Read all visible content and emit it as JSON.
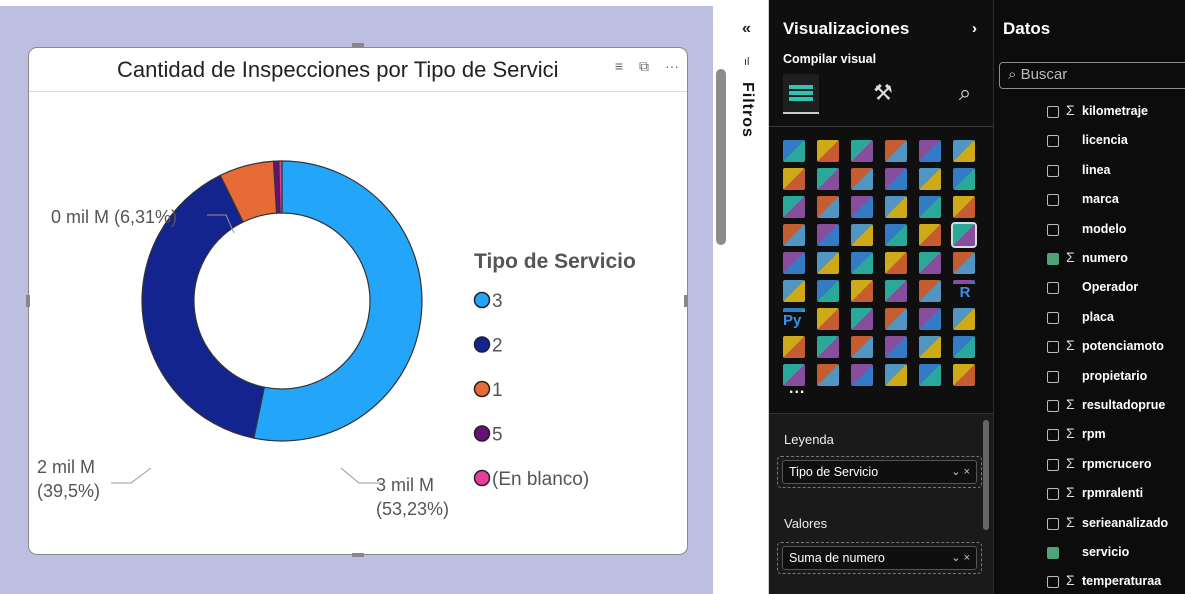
{
  "chart_data": {
    "type": "pie",
    "title": "Cantidad de Inspecciones por Tipo de Servicio",
    "legend_title": "Tipo de Servicio",
    "legend_position": "right",
    "donut": true,
    "categories": [
      "3",
      "2",
      "1",
      "5",
      "(En blanco)"
    ],
    "values": [
      53.23,
      39.5,
      6.31,
      0.6,
      0.36
    ],
    "colors": [
      "#23a5fa",
      "#13248f",
      "#e66b36",
      "#6a0e7c",
      "#e53f9b"
    ],
    "data_labels": [
      {
        "value": "3 mil M",
        "pct": "(53,23%)"
      },
      {
        "value": "2 mil M",
        "pct": "(39,5%)"
      },
      {
        "value": "0 mil M (6,31%)"
      }
    ]
  },
  "visual": {
    "title": "Cantidad de Inspecciones por Tipo de Servici",
    "filter_icon": "filter-icon",
    "focus_icon": "focus-mode-icon",
    "more_icon": "more-options-icon"
  },
  "filters_pane": {
    "label": "Filtros",
    "collapse_glyph": "«",
    "icon_glyph": "ıl"
  },
  "viz_pane": {
    "title": "Visualizaciones",
    "expand_glyph": "›",
    "subtitle": "Compilar visual",
    "more": "...",
    "wells": [
      {
        "label": "Leyenda",
        "field": "Tipo de Servicio"
      },
      {
        "label": "Valores",
        "field": "Suma de numero"
      }
    ],
    "well_ctl": "⌄  ×",
    "py_label": "Py",
    "r_label": "R"
  },
  "datos_pane": {
    "title": "Datos",
    "search_placeholder": "Buscar",
    "fields": [
      {
        "name": "kilometraje",
        "sigma": true,
        "checked": false
      },
      {
        "name": "licencia",
        "sigma": false,
        "checked": false
      },
      {
        "name": "linea",
        "sigma": false,
        "checked": false
      },
      {
        "name": "marca",
        "sigma": false,
        "checked": false
      },
      {
        "name": "modelo",
        "sigma": false,
        "checked": false
      },
      {
        "name": "numero",
        "sigma": true,
        "checked": true
      },
      {
        "name": "Operador",
        "sigma": false,
        "checked": false
      },
      {
        "name": "placa",
        "sigma": false,
        "checked": false
      },
      {
        "name": "potenciamoto",
        "sigma": true,
        "checked": false
      },
      {
        "name": "propietario",
        "sigma": false,
        "checked": false
      },
      {
        "name": "resultadoprue",
        "sigma": true,
        "checked": false
      },
      {
        "name": "rpm",
        "sigma": true,
        "checked": false
      },
      {
        "name": "rpmcrucero",
        "sigma": true,
        "checked": false
      },
      {
        "name": "rpmralenti",
        "sigma": true,
        "checked": false
      },
      {
        "name": "serieanalizado",
        "sigma": true,
        "checked": false
      },
      {
        "name": "servicio",
        "sigma": false,
        "checked": true
      },
      {
        "name": "temperaturaa",
        "sigma": true,
        "checked": false
      }
    ]
  },
  "colors": {
    "canvas_bg": "#bdbfe0",
    "pane_bg": "#0f0f0f",
    "checked": "#4fa37a"
  }
}
